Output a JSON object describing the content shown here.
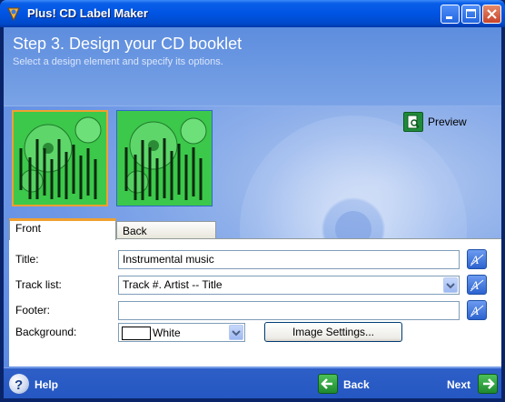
{
  "window": {
    "title": "Plus! CD Label Maker"
  },
  "header": {
    "title": "Step 3. Design your CD booklet",
    "subtitle": "Select a design element and specify its options."
  },
  "preview": {
    "label": "Preview"
  },
  "tabs": [
    {
      "label": "Front",
      "active": true
    },
    {
      "label": "Back",
      "active": false
    }
  ],
  "form": {
    "title_label": "Title:",
    "title_value": "Instrumental music",
    "tracklist_label": "Track list:",
    "tracklist_value": "Track #. Artist -- Title",
    "footer_label": "Footer:",
    "footer_value": "",
    "background_label": "Background:",
    "background_value": "White",
    "background_color": "#ffffff",
    "image_settings_label": "Image Settings..."
  },
  "footer": {
    "help_label": "Help",
    "back_label": "Back",
    "next_label": "Next"
  },
  "colors": {
    "accent": "#f0a030",
    "thumbnail_green": "#3cc84a"
  }
}
